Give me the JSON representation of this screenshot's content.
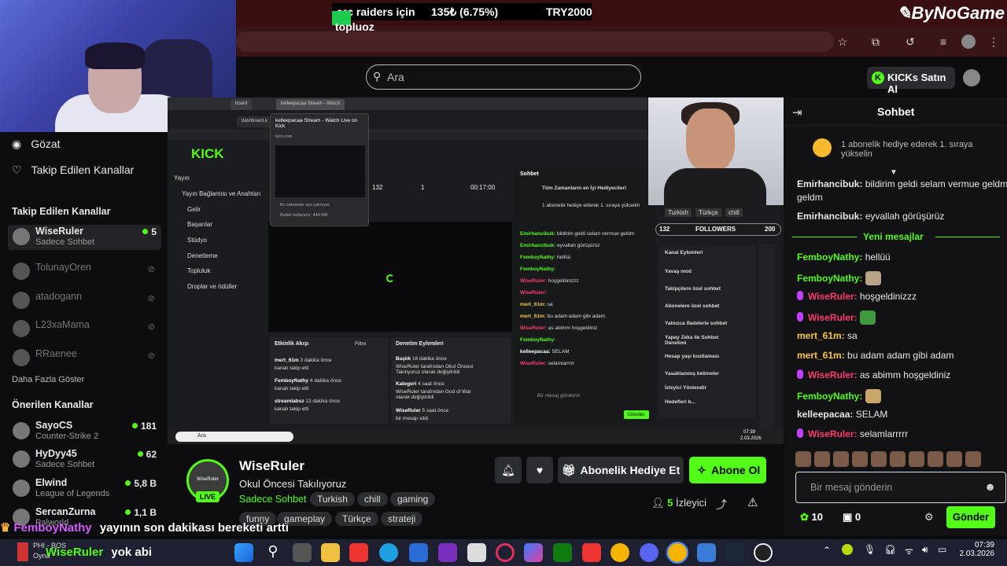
{
  "overlay": {
    "game": "arc raiders için",
    "sub": "topluoz",
    "percent": "135₺ (6.75%)",
    "price": "TRY2000",
    "brand": "ByNoGame"
  },
  "header": {
    "search_placeholder": "Ara",
    "kicks_button": "KICKs Satın Al"
  },
  "sidebar": {
    "browse": "Gözat",
    "following": "Takip Edilen Kanallar",
    "following_heading": "Takip Edilen Kanallar",
    "followed": [
      {
        "name": "WiseRuler",
        "sub": "Sadece Sohbet",
        "count": "5",
        "live": true
      },
      {
        "name": "TolunayOren",
        "live": false
      },
      {
        "name": "atadogann",
        "live": false
      },
      {
        "name": "L23xaMama",
        "live": false
      },
      {
        "name": "RRaenee",
        "live": false
      }
    ],
    "show_more": "Daha Fazla Göster",
    "recommended_heading": "Önerilen Kanallar",
    "recommended": [
      {
        "name": "SayoCS",
        "sub": "Counter-Strike 2",
        "count": "181"
      },
      {
        "name": "HyDyy45",
        "sub": "Sadece Sohbet",
        "count": "62"
      },
      {
        "name": "Elwind",
        "sub": "League of Legends",
        "count": "5,8 B"
      },
      {
        "name": "SercanZurna",
        "sub": "Palworld",
        "count": "1,1 B"
      }
    ]
  },
  "video": {
    "tabs": [
      "board",
      "kelleepacaa Stream - Watch",
      "dashboard.k"
    ],
    "tooltip_title": "kelleepacaa Stream - Watch Live on Kick",
    "tooltip_url": "kick.com",
    "tooltip_audio": "Bu sekmede ses çalınıyor",
    "tooltip_mem": "Bellek kullanımı: 449 MB",
    "nav": [
      "Yayın",
      "Yayın Bağlantısı ve Anahtarı",
      "Gelir",
      "Başarılar",
      "Stüdyo",
      "Denetleme",
      "Topluluk",
      "Droplar ve ödüller"
    ],
    "stats": [
      "132",
      "1",
      "00:17:00"
    ],
    "activity_title": "Etkinlik Akışı",
    "activity_filter": "Filtre",
    "activity": [
      {
        "user": "mert_61m",
        "desc": "kanalı takip etti",
        "time": "3 dakika önce"
      },
      {
        "user": "FemboyNathy",
        "desc": "kanalı takip etti",
        "time": "4 dakika önce"
      },
      {
        "user": "streamlabsz",
        "desc": "kanalı takip etti",
        "time": "13 dakika önce"
      }
    ],
    "mod_title": "Denetim Eylemleri",
    "mod": [
      {
        "h": "Başlık",
        "d": "WiseRuler tarafından Okul Öncesi Takılıyoruz olarak değiştirildi",
        "time": "16 dakika önce"
      },
      {
        "h": "Kategori",
        "d": "WiseRuler tarafından God of War olarak değiştirildi",
        "time": "4 saat önce"
      },
      {
        "h": "WiseRuler",
        "d": "bir mesajı sildi",
        "time": "5 saat önce"
      }
    ],
    "chat_title": "Sohbet",
    "chat_sub": "Tüm Zamanların en İyi Hediyecileri",
    "chat_gift": "1 abonelik hediye ederek 1. sıraya yükselin",
    "chat_lines": [
      {
        "u": "Emirhancibuk:",
        "t": "bildirim geldi selam vermue geldm"
      },
      {
        "u": "Emirhancibuk:",
        "t": "eyvallah görüşürüz"
      },
      {
        "u": "FemboyNathy:",
        "t": "hellüü"
      },
      {
        "u": "FemboyNathy:",
        "t": ""
      },
      {
        "u": "WiseRuler:",
        "t": "hoşgeldinizzz"
      },
      {
        "u": "WiseRuler:",
        "t": ""
      },
      {
        "u": "mert_61m:",
        "t": "sa"
      },
      {
        "u": "mert_61m:",
        "t": "bu adam adam gibi adam"
      },
      {
        "u": "WiseRuler:",
        "t": "as abimm hoşgeldiniz"
      },
      {
        "u": "FemboyNathy:",
        "t": ""
      },
      {
        "u": "kelleepacaa:",
        "t": "SELAM"
      },
      {
        "u": "WiseRuler:",
        "t": "selamlarrrrr"
      }
    ],
    "chat_input": "Bir mesaj gönderin",
    "chat_send": "Gönder",
    "cam_tags": [
      "Turkish",
      "Türkçe",
      "chill"
    ],
    "followers_left": "132",
    "followers_label": "FOLLOWERS",
    "followers_right": "200",
    "modpanel_title": "Kanal Eylemleri",
    "modpanel": [
      "Yavaş mod",
      "Takipçilere özel sohbet",
      "Abonelere özel sohbet",
      "Yalnızca ifadelerle sohbet",
      "Yapay Zeka ile Sohbet Denetimi",
      "Hesap yaşı kısıtlaması",
      "Yasaklanmış kelimeler",
      "İzleyici Yönlendir",
      "Hedefleri b..."
    ],
    "taskbar_search": "Ara",
    "taskbar_time": "07:39",
    "taskbar_date": "2.03.2026"
  },
  "channel": {
    "name": "WiseRuler",
    "avatar_text": "WiseRuler",
    "live": "LIVE",
    "title": "Okul Öncesi Takılıyoruz",
    "category": "Sadece Sohbet",
    "tags": [
      "Turkish",
      "chill",
      "gaming",
      "funny",
      "gameplay",
      "Türkçe",
      "strateji"
    ],
    "gift_button": "Abonelik Hediye Et",
    "subscribe_button": "Abone Ol",
    "viewers_count": "5",
    "viewers_label": "İzleyici"
  },
  "chat": {
    "title": "Sohbet",
    "gift_banner": "1 abonelik hediye ederek 1. sıraya yükselin",
    "new_messages": "Yeni mesajlar",
    "messages_before": [
      {
        "user": "Emirhancibuk:",
        "text": "bildirim geldi selam vermue geldm",
        "color": "#e8e8e8"
      },
      {
        "user": "Emirhancibuk:",
        "text": "eyvallah görüşürüz",
        "color": "#e8e8e8"
      }
    ],
    "messages_after": [
      {
        "user": "FemboyNathy:",
        "text": "hellüü",
        "color": "#53fc18",
        "mic": false
      },
      {
        "user": "FemboyNathy:",
        "text": "",
        "color": "#53fc18",
        "mic": false
      },
      {
        "user": "WiseRuler:",
        "text": "hoşgeldinizzz",
        "color": "#ff3d6e",
        "mic": true
      },
      {
        "user": "WiseRuler:",
        "text": "",
        "color": "#ff3d6e",
        "mic": true
      },
      {
        "user": "mert_61m:",
        "text": "sa",
        "color": "#f5c542",
        "mic": false
      },
      {
        "user": "mert_61m:",
        "text": "bu adam adam gibi adam",
        "color": "#f5c542",
        "mic": false
      },
      {
        "user": "WiseRuler:",
        "text": "as abimm hoşgeldiniz",
        "color": "#ff3d6e",
        "mic": true
      },
      {
        "user": "FemboyNathy:",
        "text": "",
        "color": "#53fc18",
        "mic": false
      },
      {
        "user": "kelleepacaa:",
        "text": "SELAM",
        "color": "#e8e8e8",
        "mic": false
      },
      {
        "user": "WiseRuler:",
        "text": "selamlarrrrr",
        "color": "#ff3d6e",
        "mic": true
      }
    ],
    "input_placeholder": "Bir mesaj gönderin",
    "kicks": "10",
    "gifts": "0",
    "send": "Gönder"
  },
  "alert": {
    "user1": "FemboyNathy",
    "msg1": "yayının son dakikası bereketi arttı",
    "user2": "WiseRuler",
    "msg2": "yok abi"
  },
  "taskbar": {
    "media_title": "PHI - BOS",
    "media_sub": "Oyna",
    "time": "07:39",
    "date": "2.03.2026"
  }
}
